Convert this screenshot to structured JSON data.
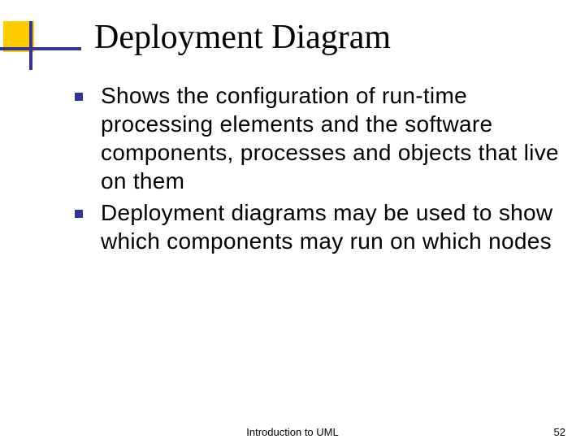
{
  "title": "Deployment Diagram",
  "bullets": [
    "Shows the configuration of run-time processing elements and the software components, processes and objects that live on them",
    "Deployment diagrams may be used to show which components may run on which nodes"
  ],
  "footer": {
    "title": "Introduction to UML",
    "page": "52"
  }
}
